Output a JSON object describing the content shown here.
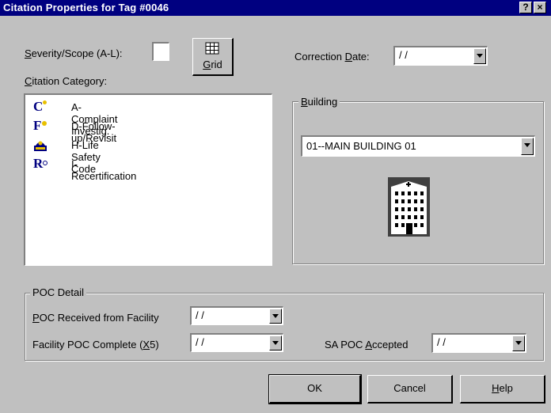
{
  "window": {
    "title": "Citation Properties for Tag #0046",
    "help_button": "?",
    "close_button": "×"
  },
  "severity": {
    "label_prefix": "S",
    "label_rest": "everity/Scope (A-L):",
    "value": ""
  },
  "grid_button": {
    "label_prefix": "G",
    "label_rest": "rid"
  },
  "correction_date": {
    "label_prefix": "Correction ",
    "label_key": "D",
    "label_rest": "ate:",
    "value": "/ /"
  },
  "citation_category": {
    "label_key": "C",
    "label_rest": "itation Category:",
    "items": [
      {
        "icon": "C",
        "icon_name": "complaint-icon",
        "label": "A-Complaint Investig."
      },
      {
        "icon": "F",
        "icon_name": "follow-up-icon",
        "label": "D-Follow-up/Revisit"
      },
      {
        "icon": "",
        "icon_name": "life-safety-icon",
        "label": "H-Life Safety Code"
      },
      {
        "icon": "R",
        "icon_name": "recertification-icon",
        "label": "I-Recertification"
      }
    ]
  },
  "building": {
    "label_key": "B",
    "label_rest": "uilding",
    "value": "01--MAIN BUILDING 01"
  },
  "poc_detail": {
    "label": "POC Detail",
    "received": {
      "label_key": "P",
      "label_rest": "OC Received from Facility",
      "value": "/ /"
    },
    "complete": {
      "label_prefix": "Facility POC Complete (",
      "label_key": "X",
      "label_rest": "5)",
      "value": "/ /"
    },
    "accepted": {
      "label_prefix": "SA POC ",
      "label_key": "A",
      "label_rest": "ccepted",
      "value": "/ /"
    }
  },
  "buttons": {
    "ok": "OK",
    "cancel": "Cancel",
    "help_key": "H",
    "help_rest": "elp"
  },
  "colors": {
    "titlebar": "#000080",
    "face": "#c0c0c0",
    "icon_blue": "#000080"
  }
}
